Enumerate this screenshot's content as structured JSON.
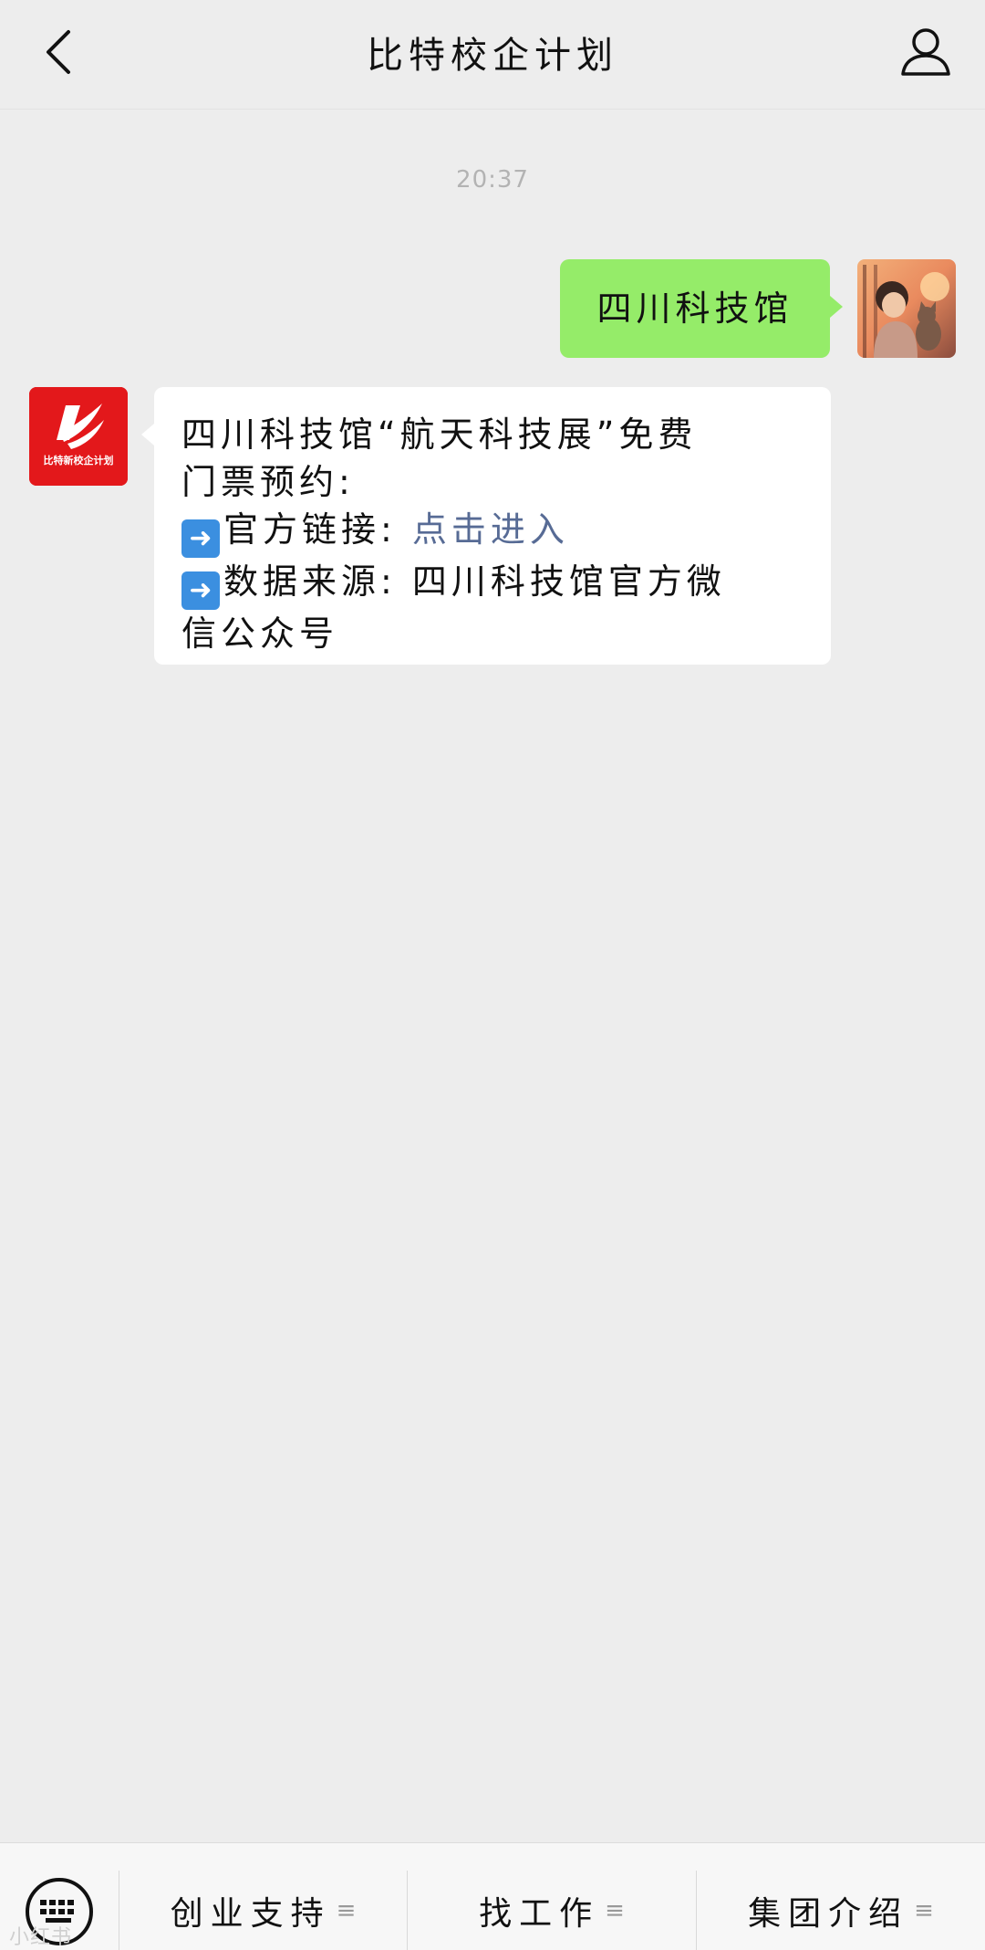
{
  "header": {
    "title": "比特校企计划"
  },
  "chat": {
    "timestamp": "20:37",
    "outgoing_message": "四川科技馆",
    "bot_avatar_text": "比特新校企计划",
    "incoming": {
      "line1": "四川科技馆“航天科技展”免费",
      "line2": "门票预约:",
      "line3_label": "官方链接:",
      "line3_link": "点击进入",
      "line4": "数据来源: 四川科技馆官方微",
      "line5": "信公众号"
    }
  },
  "menu": {
    "items": [
      {
        "label": "创业支持"
      },
      {
        "label": "找工作"
      },
      {
        "label": "集团介绍"
      }
    ],
    "menu_icon": "≡"
  },
  "watermark": "小红书"
}
